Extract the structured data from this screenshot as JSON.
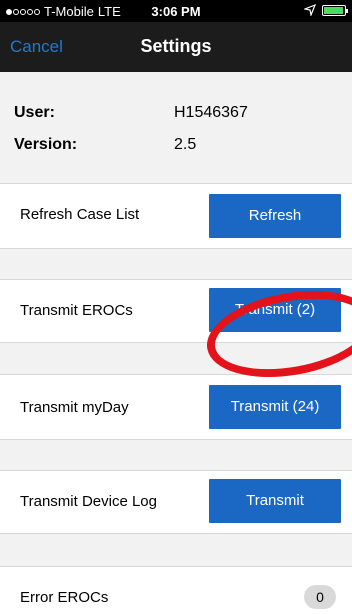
{
  "status_bar": {
    "carrier": "T-Mobile",
    "network": "LTE",
    "time": "3:06 PM"
  },
  "nav": {
    "cancel_label": "Cancel",
    "title": "Settings"
  },
  "info": {
    "user_label": "User:",
    "user_value": "H1546367",
    "version_label": "Version:",
    "version_value": "2.5"
  },
  "rows": [
    {
      "label": "Refresh Case List",
      "button": "Refresh"
    },
    {
      "label": "Transmit EROCs",
      "button": "Transmit (2)"
    },
    {
      "label": "Transmit myDay",
      "button": "Transmit (24)"
    },
    {
      "label": "Transmit Device Log",
      "button": "Transmit"
    },
    {
      "label": "Error EROCs",
      "badge": "0"
    }
  ],
  "colors": {
    "accent": "#1b68c4",
    "nav_bg": "#1c1c1c",
    "annotation": "#e3121b"
  }
}
